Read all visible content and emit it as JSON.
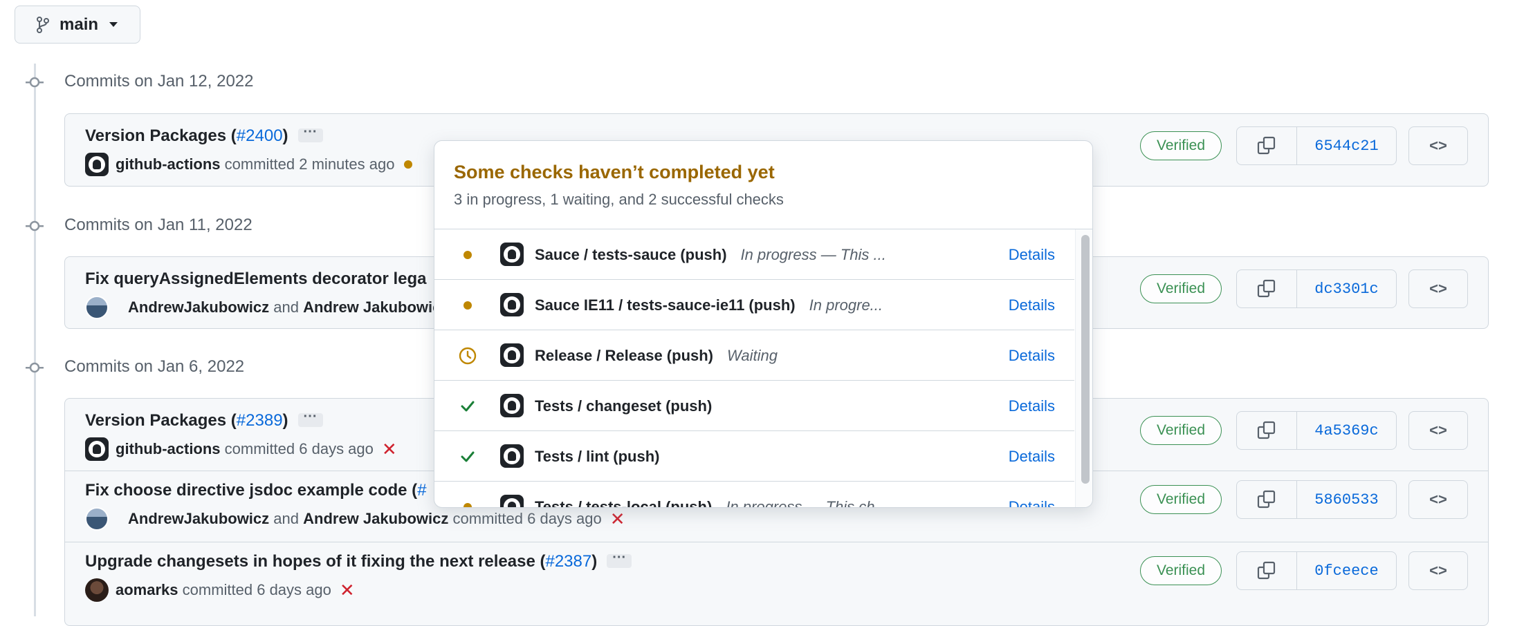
{
  "branch": {
    "name": "main"
  },
  "groups": [
    {
      "title": "Commits on Jan 12, 2022"
    },
    {
      "title": "Commits on Jan 11, 2022"
    },
    {
      "title": "Commits on Jan 6, 2022"
    }
  ],
  "commits": [
    {
      "message": "Version Packages (",
      "pr": "#2400",
      "close": ")",
      "authors": [
        "github-actions"
      ],
      "join": "",
      "meta": "committed 2 minutes ago",
      "status": "pending",
      "verified": "Verified",
      "sha": "6544c21"
    },
    {
      "message": "Fix queryAssignedElements decorator lega",
      "pr": "",
      "close": "",
      "authors": [
        "AndrewJakubowicz",
        "Andrew Jakubowic"
      ],
      "join": "and",
      "meta": "",
      "status": "",
      "verified": "Verified",
      "sha": "dc3301c"
    },
    {
      "message": "Version Packages (",
      "pr": "#2389",
      "close": ")",
      "authors": [
        "github-actions"
      ],
      "join": "",
      "meta": "committed 6 days ago",
      "status": "failure",
      "verified": "Verified",
      "sha": "4a5369c"
    },
    {
      "message": "Fix choose directive jsdoc example code (",
      "pr": "#",
      "close": "",
      "authors": [
        "AndrewJakubowicz",
        "Andrew Jakubowicz"
      ],
      "join": "and",
      "meta": "committed 6 days ago",
      "status": "failure",
      "verified": "Verified",
      "sha": "5860533"
    },
    {
      "message": "Upgrade changesets in hopes of it fixing the next release (",
      "pr": "#2387",
      "close": ")",
      "authors": [
        "aomarks"
      ],
      "join": "",
      "meta": "committed 6 days ago",
      "status": "failure",
      "verified": "Verified",
      "sha": "0fceece"
    }
  ],
  "popover": {
    "title": "Some checks haven’t completed yet",
    "subtitle": "3 in progress, 1 waiting, and 2 successful checks",
    "checks": [
      {
        "name": "Sauce / tests-sauce (push)",
        "desc": "In progress — This ...",
        "status": "in-progress",
        "link": "Details"
      },
      {
        "name": "Sauce IE11 / tests-sauce-ie11 (push)",
        "desc": "In progre...",
        "status": "in-progress",
        "link": "Details"
      },
      {
        "name": "Release / Release (push)",
        "desc": "Waiting",
        "status": "waiting",
        "link": "Details"
      },
      {
        "name": "Tests / changeset (push)",
        "desc": "",
        "status": "success",
        "link": "Details"
      },
      {
        "name": "Tests / lint (push)",
        "desc": "",
        "status": "success",
        "link": "Details"
      },
      {
        "name": "Tests / tests-local (push)",
        "desc": "In progress — This ch",
        "status": "in-progress",
        "link": "Details"
      }
    ]
  },
  "icons": {
    "branch": "git-branch-icon",
    "commit_node": "git-commit-icon",
    "copy": "copy-icon",
    "browse": "code-icon",
    "status_pending": "dot-fill-icon",
    "status_failure": "x-icon",
    "status_waiting": "clock-icon",
    "status_success": "check-icon"
  },
  "colors": {
    "accent": "#0969da",
    "pending": "#bf8700",
    "success": "#1a7f37",
    "failure": "#cf222e",
    "popover_title": "#9a6700"
  }
}
